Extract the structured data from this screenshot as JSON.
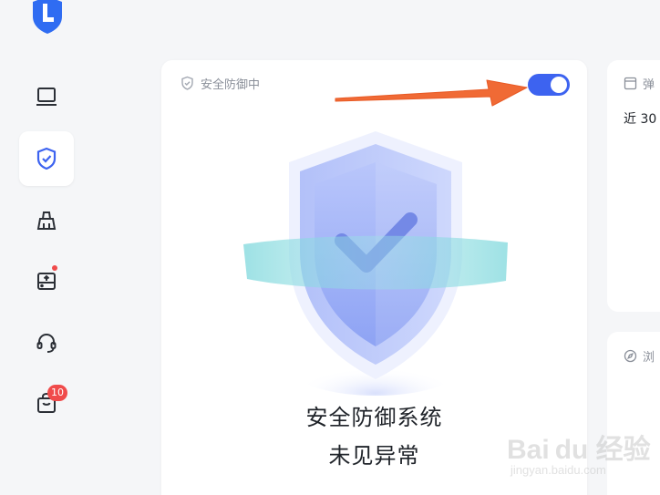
{
  "sidebar": {
    "logo_icon": "app-logo-shield",
    "items": [
      {
        "name": "computer-icon",
        "active": false
      },
      {
        "name": "shield-check-icon",
        "active": true
      },
      {
        "name": "broom-icon",
        "active": false
      },
      {
        "name": "drive-icon",
        "active": false,
        "dot": true
      },
      {
        "name": "headset-icon",
        "active": false
      },
      {
        "name": "bag-icon",
        "active": false,
        "badge": "10"
      }
    ]
  },
  "main_card": {
    "status_label": "安全防御中",
    "toggle_on": true,
    "title": "安全防御系统",
    "subtitle": "未见异常"
  },
  "right_top_card": {
    "header": "弹",
    "body": "近 30"
  },
  "right_bottom_card": {
    "header": "浏"
  },
  "watermark": {
    "line1": "Bai du 经验",
    "line2": "jingyan.baidu.com"
  },
  "colors": {
    "accent": "#3d63f0",
    "arrow": "#f06a35",
    "badge": "#f04b4b"
  }
}
